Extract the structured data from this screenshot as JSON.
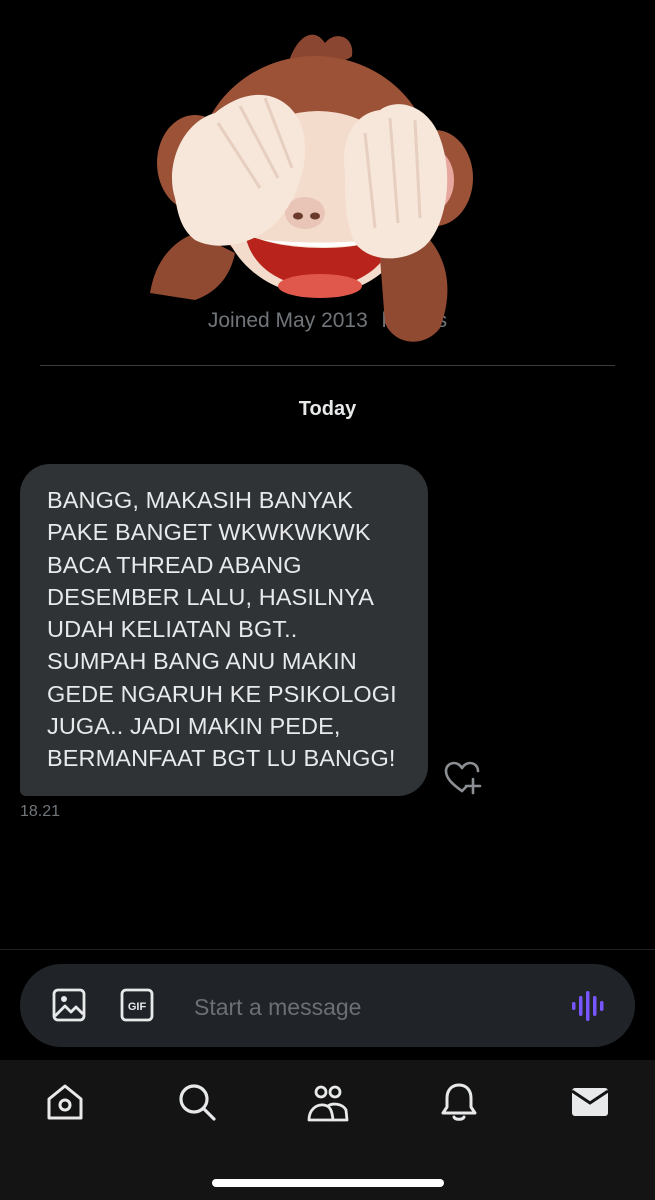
{
  "profile": {
    "joined": "Joined May 2013",
    "followers_partial": "llowers"
  },
  "sticker": {
    "name": "see-no-evil-monkey-emoji",
    "colors": {
      "fur": "#9b5237",
      "face": "#f4dccc",
      "hands": "#f7e6da",
      "mouth": "#b8241c"
    }
  },
  "conversation": {
    "date_label": "Today",
    "messages": [
      {
        "text": "BANGG, MAKASIH BANYAK\nPAKE BANGET WKWKWKWK\nBACA THREAD ABANG\nDESEMBER LALU, HASILNYA\nUDAH KELIATAN BGT..\nSUMPAH BANG ANU MAKIN\nGEDE NGARUH KE PSIKOLOGI\nJUGA.. JADI MAKIN PEDE,\nBERMANFAAT BGT LU BANGG!",
        "time": "18.21",
        "reaction_icon": "heart-plus-icon"
      }
    ]
  },
  "composer": {
    "placeholder": "Start a message",
    "value": "",
    "gif_label": "GIF",
    "icons": [
      "image-icon",
      "gif-icon",
      "voice-wave-icon"
    ]
  },
  "tabs": [
    {
      "name": "home",
      "icon": "home-icon"
    },
    {
      "name": "search",
      "icon": "search-icon"
    },
    {
      "name": "communities",
      "icon": "communities-icon"
    },
    {
      "name": "notifications",
      "icon": "bell-icon"
    },
    {
      "name": "messages",
      "icon": "mail-icon"
    }
  ],
  "colors": {
    "background": "#000000",
    "bubble": "#2f3336",
    "text": "#e7e9ea",
    "muted": "#71767b",
    "accent_voice": "#7856ff"
  }
}
